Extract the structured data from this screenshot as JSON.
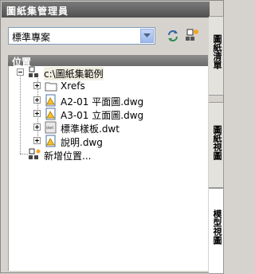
{
  "window": {
    "title": "圖紙集管理員"
  },
  "selector": {
    "value": "標準專案"
  },
  "toolbar": {
    "refresh_icon": "refresh-icon",
    "new_location_icon": "new-location-icon"
  },
  "section": {
    "header": "位置"
  },
  "tree": {
    "root": {
      "label": "c:\\圖紙集範例",
      "icon": "sheetset-location-icon"
    },
    "children": [
      {
        "label": "Xrefs",
        "icon": "folder-icon"
      },
      {
        "label": "A2-01 平面圖.dwg",
        "icon": "dwg-file-icon"
      },
      {
        "label": "A3-01 立面圖.dwg",
        "icon": "dwg-file-icon"
      },
      {
        "label": "標準樣板.dwt",
        "icon": "dwt-template-icon"
      },
      {
        "label": "說明.dwg",
        "icon": "dwg-file-icon"
      }
    ],
    "add": {
      "label": "新增位置...",
      "icon": "add-location-icon"
    }
  },
  "tabs": [
    {
      "label": "圖紙清單",
      "active": false
    },
    {
      "label": "圖紙視圖",
      "active": false
    },
    {
      "label": "模型視圖",
      "active": true
    }
  ]
}
